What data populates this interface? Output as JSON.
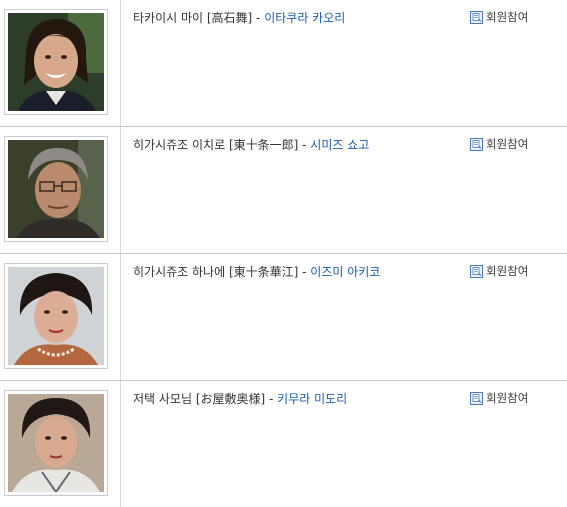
{
  "cast": [
    {
      "role": "타카이시 마이 [高石舞]",
      "separator": " - ",
      "actor": "이타쿠라 카오리",
      "join_label": "회원참여",
      "photo_icon": "portrait-young-woman"
    },
    {
      "role": "히가시쥬조 이치로 [東十条一郎]",
      "separator": " - ",
      "actor": "시미즈 쇼고",
      "join_label": "회원참여",
      "photo_icon": "portrait-older-man-glasses"
    },
    {
      "role": "히가시쥬조 하나에 [東十条華江]",
      "separator": " - ",
      "actor": "이즈미 아키코",
      "join_label": "회원참여",
      "photo_icon": "portrait-woman-pearls"
    },
    {
      "role": "저택 사모님 [お屋敷奥様]",
      "separator": " - ",
      "actor": "키무라 미도리",
      "join_label": "회원참여",
      "photo_icon": "portrait-woman-kimono"
    }
  ],
  "colors": {
    "actor_link": "#1a5da8",
    "divider": "#c8c8c8",
    "icon_blue": "#4a78b8"
  }
}
